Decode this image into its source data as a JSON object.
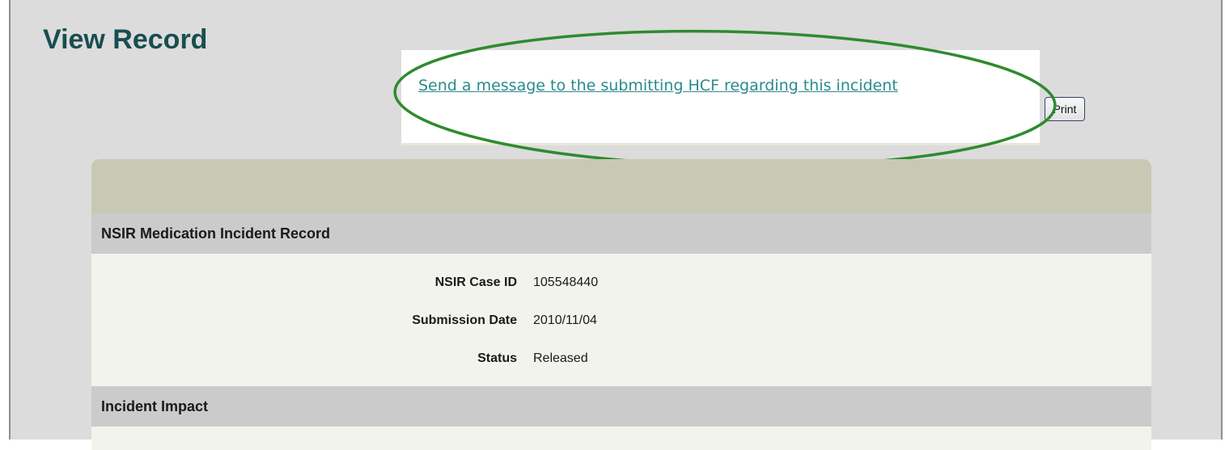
{
  "page": {
    "title": "View Record"
  },
  "actions": {
    "message_link": "Send a message to the submitting HCF regarding this incident",
    "print_label": "Print"
  },
  "highlight": {
    "color": "#2e8b2e"
  },
  "record": {
    "section_title": "NSIR Medication Incident Record",
    "fields": [
      {
        "label": "NSIR Case ID",
        "value": "105548440"
      },
      {
        "label": "Submission Date",
        "value": "2010/11/04"
      },
      {
        "label": "Status",
        "value": "Released"
      }
    ],
    "next_section_title": "Incident Impact"
  },
  "colors": {
    "title": "#1a4d50",
    "link": "#2b8a8a",
    "card_header": "#c8c8b4",
    "section_header": "#cbcbcb",
    "section_body": "#f3f3ee"
  }
}
